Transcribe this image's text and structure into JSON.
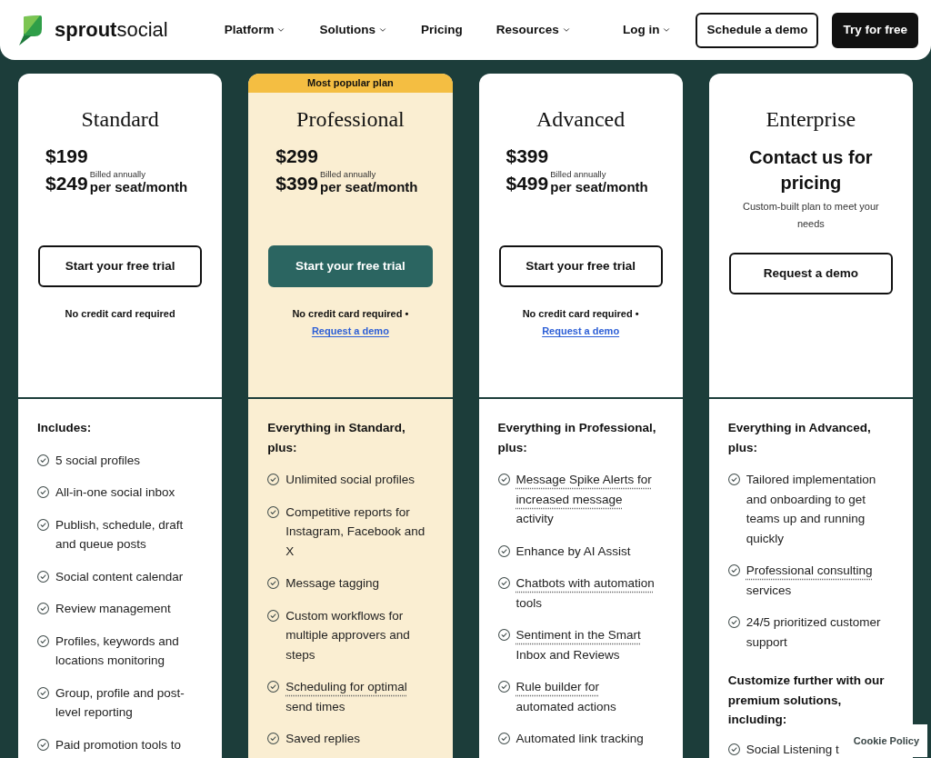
{
  "header": {
    "logo_text": "**sprout**social",
    "nav": [
      {
        "label": "Platform",
        "dropdown": true
      },
      {
        "label": "Solutions",
        "dropdown": true
      },
      {
        "label": "Pricing",
        "dropdown": false
      },
      {
        "label": "Resources",
        "dropdown": true
      }
    ],
    "login": {
      "label": "Log in",
      "dropdown": true
    },
    "buttons": [
      {
        "label": "Schedule a demo",
        "kind": "outline"
      },
      {
        "label": "Try for free",
        "kind": "solid"
      }
    ]
  },
  "plans": [
    {
      "name": "Standard",
      "kind": "price",
      "highlighted": false,
      "price": "$199",
      "second_price": "$249",
      "billing_note": "Billed annually",
      "unit": "per seat/month",
      "cta": {
        "label": "Start your free trial",
        "kind": "outline"
      },
      "note": "No credit card required",
      "features": {
        "heading": "Includes:",
        "items": [
          {
            "text": "5 social profiles"
          },
          {
            "text": "All-in-one social inbox"
          },
          {
            "text": "Publish, schedule, draft and queue posts"
          },
          {
            "text": "Social content calendar"
          },
          {
            "text": "Review management"
          },
          {
            "text": "Profiles, keywords and locations monitoring"
          },
          {
            "text": "Group, profile and post-level reporting"
          },
          {
            "text": "Paid promotion tools to"
          }
        ]
      }
    },
    {
      "name": "Professional",
      "kind": "price",
      "highlighted": true,
      "banner": "Most popular plan",
      "price": "$299",
      "second_price": "$399",
      "billing_note": "Billed annually",
      "unit": "per seat/month",
      "cta": {
        "label": "Start your free trial",
        "kind": "solid"
      },
      "note": "No credit card required •",
      "link": "Request a demo",
      "features": {
        "heading": "Everything in Standard, plus:",
        "items": [
          {
            "text": "Unlimited social profiles"
          },
          {
            "text": "Competitive reports for Instagram, Facebook and X"
          },
          {
            "text": "Message tagging"
          },
          {
            "text": "Custom workflows for multiple approvers and steps"
          },
          {
            "underlined": "Scheduling for optimal",
            "text": "send times"
          },
          {
            "text": "Saved replies"
          }
        ]
      }
    },
    {
      "name": "Advanced",
      "kind": "price",
      "highlighted": false,
      "price": "$399",
      "second_price": "$499",
      "billing_note": "Billed annually",
      "unit": "per seat/month",
      "cta": {
        "label": "Start your free trial",
        "kind": "outline"
      },
      "note": "No credit card required •",
      "link": "Request a demo",
      "features": {
        "heading": "Everything in Professional, plus:",
        "items": [
          {
            "underlined": "Message Spike Alerts for increased message",
            "text": "activity"
          },
          {
            "text": "Enhance by AI Assist"
          },
          {
            "underlined": "Chatbots with automation",
            "text": "tools"
          },
          {
            "underlined": "Sentiment in the Smart",
            "text": "Inbox and Reviews"
          },
          {
            "underlined": "Rule builder for",
            "text": "automated actions"
          },
          {
            "text": "Automated link tracking"
          }
        ]
      }
    },
    {
      "name": "Enterprise",
      "kind": "contact",
      "highlighted": false,
      "heading": "Contact us for pricing",
      "description": "Custom-built plan to meet your needs",
      "cta": {
        "label": "Request a demo",
        "kind": "outline"
      },
      "features": {
        "heading": "Everything in Advanced, plus:",
        "items": [
          {
            "text": "Tailored implementation and onboarding to get teams up and running quickly"
          },
          {
            "underlined": "Professional consulting",
            "text": "services"
          },
          {
            "text": "24/5 prioritized customer support"
          }
        ],
        "extra_heading": "Customize further with our premium solutions, including:",
        "extra_items": [
          {
            "text": "Social Listening t"
          }
        ]
      }
    }
  ],
  "cookie_banner": {
    "label": "Cookie Policy"
  }
}
